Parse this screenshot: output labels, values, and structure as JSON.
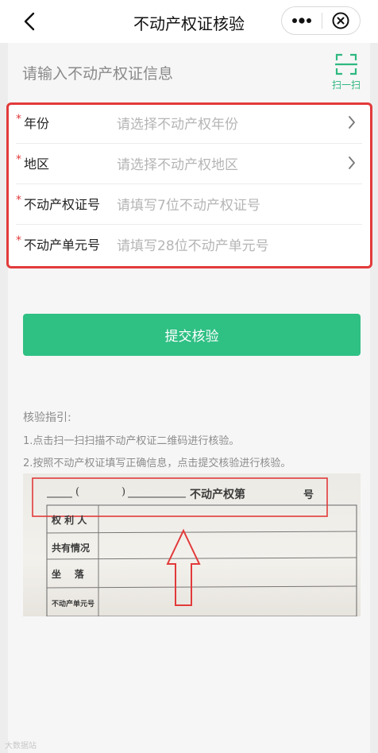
{
  "nav": {
    "title": "不动产权证核验"
  },
  "info": {
    "prompt": "请输入不动产权证信息",
    "scan_label": "扫一扫"
  },
  "form": {
    "fields": [
      {
        "label": "年份",
        "placeholder": "请选择不动产权年份",
        "has_arrow": true
      },
      {
        "label": "地区",
        "placeholder": "请选择不动产权地区",
        "has_arrow": true
      },
      {
        "label": "不动产权证号",
        "placeholder": "请填写7位不动产权证号",
        "has_arrow": false
      },
      {
        "label": "不动产单元号",
        "placeholder": "请填写28位不动产单元号",
        "has_arrow": false
      }
    ],
    "required_mark": "*",
    "submit_label": "提交核验"
  },
  "guide": {
    "title": "核验指引:",
    "steps": [
      "1.点击扫一扫扫描不动产权证二维码进行核验。",
      "2.按照不动产权证填写正确信息，点击提交核验进行核验。"
    ]
  },
  "certificate": {
    "header_open": "(",
    "header_close": ")",
    "header_text": "不动产权第",
    "header_suffix": "号",
    "rows": [
      "权 利 人",
      "共有情况",
      "坐    落",
      "不动产单元号"
    ]
  },
  "watermark": "大数据站",
  "colors": {
    "accent": "#2fc084",
    "highlight": "#e23a3a"
  }
}
